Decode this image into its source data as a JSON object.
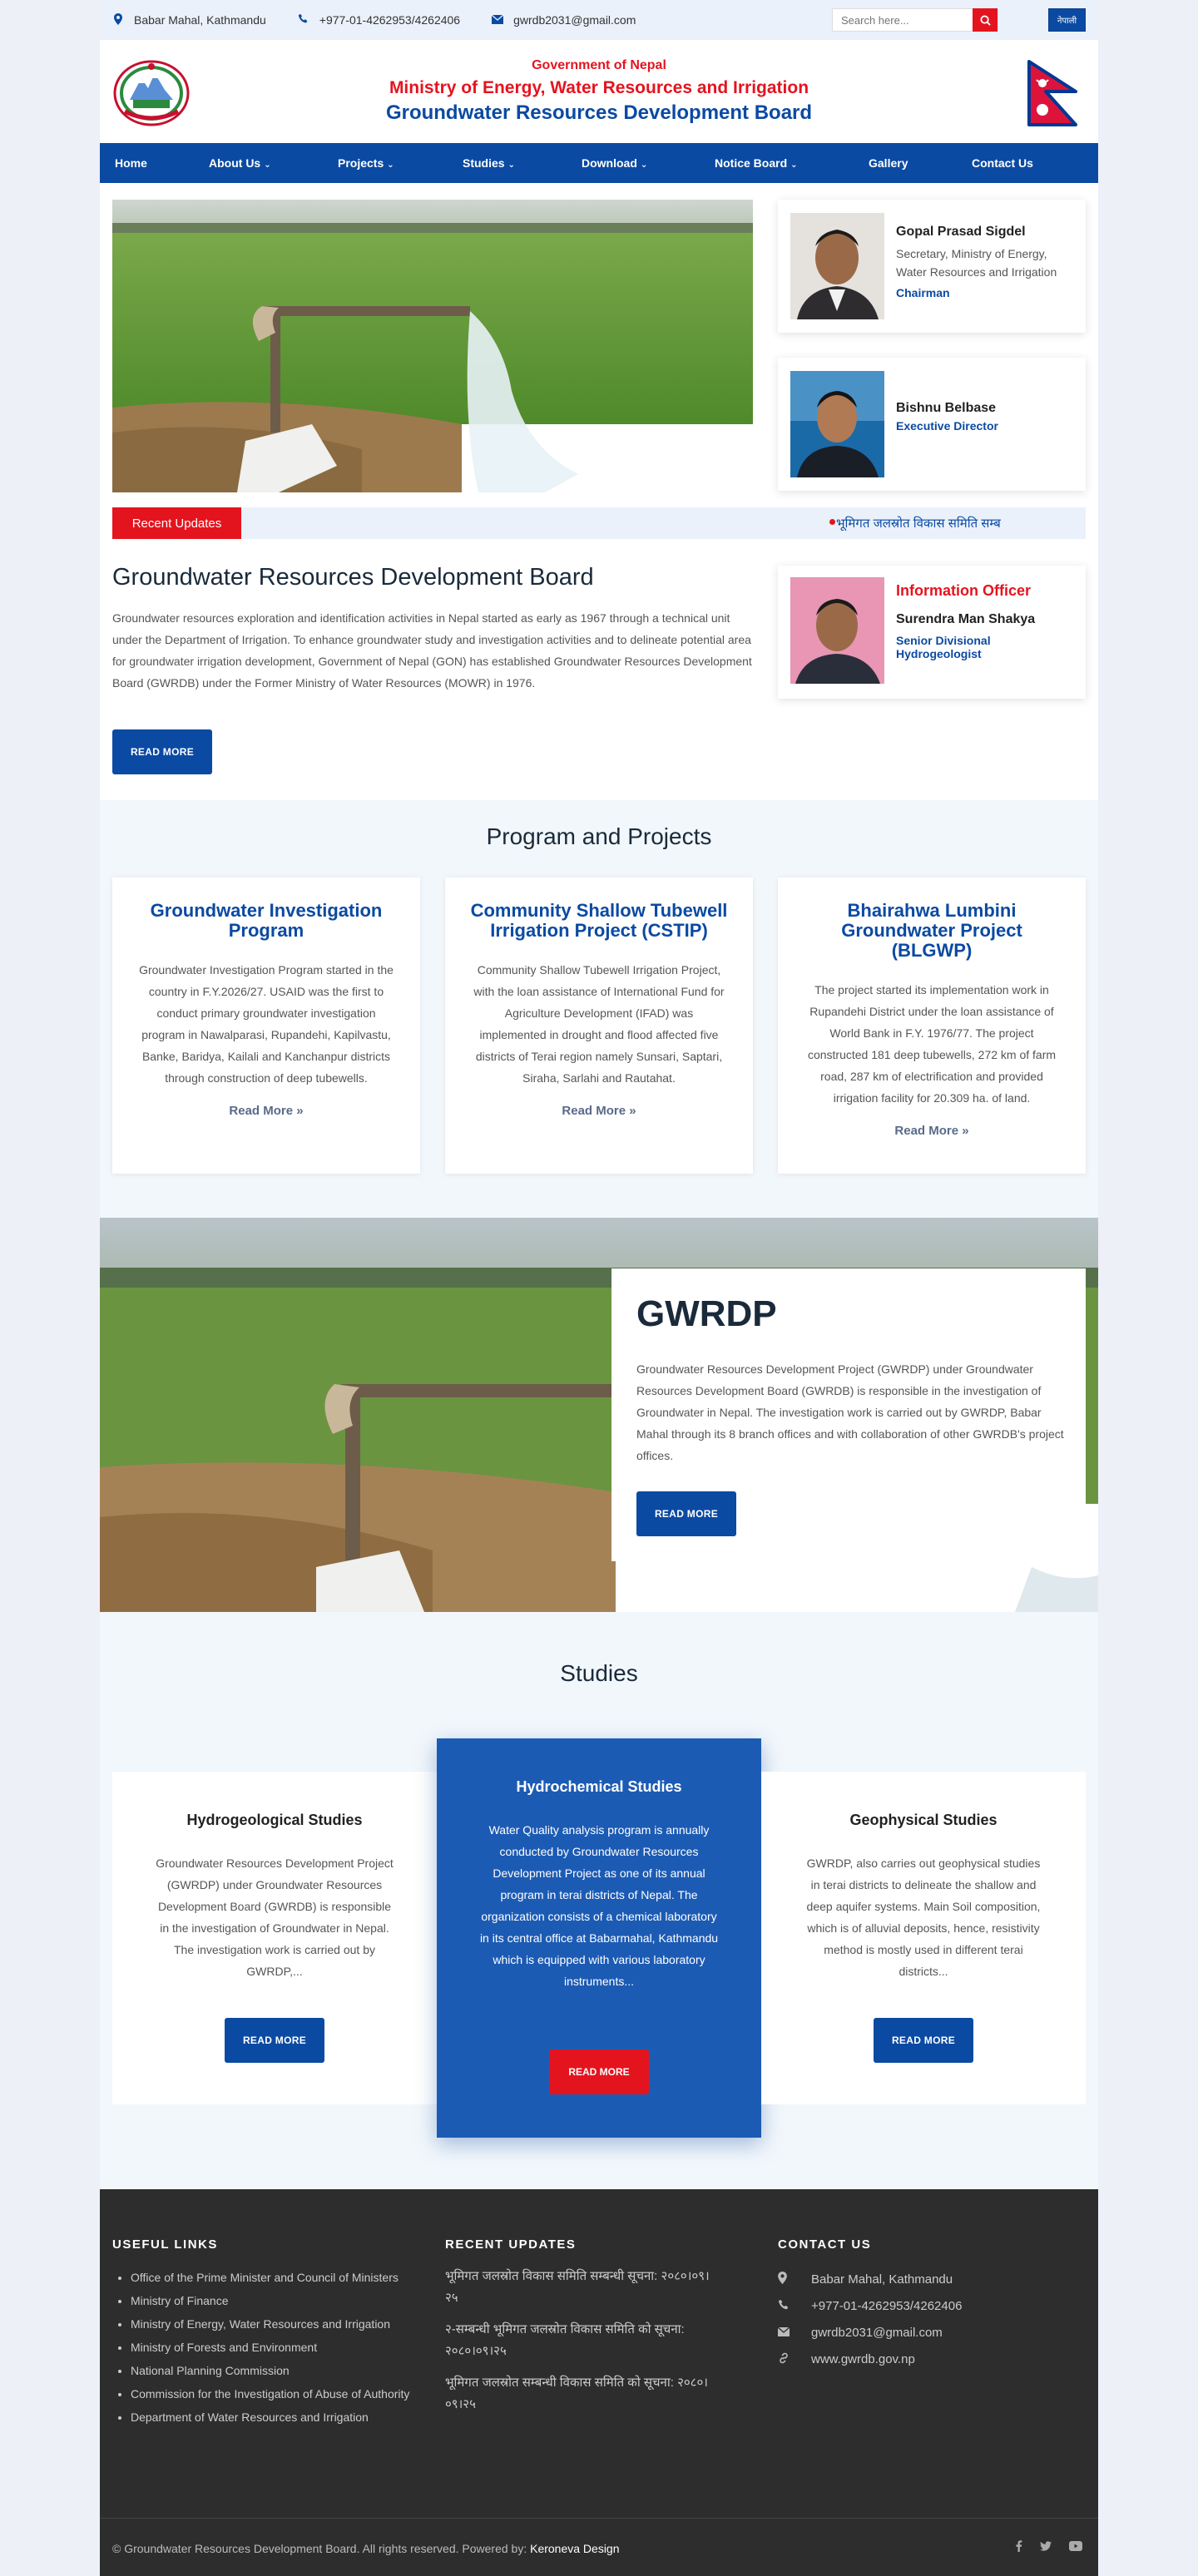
{
  "topbar": {
    "address": "Babar Mahal, Kathmandu",
    "phone": "+977-01-4262953/4262406",
    "email": "gwrdb2031@gmail.com",
    "search_placeholder": "Search here...",
    "lang_button": "नेपाली",
    "icons": [
      "map-pin-icon",
      "phone-icon",
      "envelope-icon",
      "search-icon"
    ]
  },
  "header": {
    "gov": "Government of Nepal",
    "ministry": "Ministry of Energy, Water Resources and Irrigation",
    "board": "Groundwater Resources Development Board"
  },
  "nav": [
    {
      "label": "Home",
      "dropdown": false
    },
    {
      "label": "About Us",
      "dropdown": true
    },
    {
      "label": "Projects",
      "dropdown": true
    },
    {
      "label": "Studies",
      "dropdown": true
    },
    {
      "label": "Download",
      "dropdown": true
    },
    {
      "label": "Notice Board",
      "dropdown": true
    },
    {
      "label": "Gallery",
      "dropdown": false
    },
    {
      "label": "Contact Us",
      "dropdown": false
    }
  ],
  "officials": [
    {
      "name": "Gopal Prasad Sigdel",
      "desc": "Secretary, Ministry of Energy, Water Resources and Irrigation",
      "role": "Chairman"
    },
    {
      "name": "Bishnu Belbase",
      "desc": "",
      "role": "Executive Director"
    }
  ],
  "updates": {
    "label": "Recent Updates",
    "ticker": "भूमिगत जलस्रोत विकास समिति सम्ब"
  },
  "intro": {
    "title": "Groundwater Resources Development Board",
    "text": "Groundwater resources exploration and identification activities in Nepal started as early as 1967 through a technical unit under the Department of Irrigation. To enhance groundwater study and investigation activities and to delineate potential area for groundwater irrigation development, Government of Nepal (GON) has established Groundwater Resources Development Board (GWRDB) under the Former Ministry of Water Resources (MOWR) in 1976.",
    "button": "READ MORE"
  },
  "info_officer": {
    "heading": "Information Officer",
    "name": "Surendra Man Shakya",
    "role": "Senior Divisional Hydrogeologist"
  },
  "programs": {
    "title": "Program and Projects",
    "items": [
      {
        "title": "Groundwater Investigation Program",
        "text": "Groundwater Investigation Program started in the country in F.Y.2026/27. USAID was the first to conduct primary groundwater investigation program in Nawalparasi, Rupandehi, Kapilvastu, Banke, Baridya, Kailali and Kanchanpur districts through construction of deep tubewells.",
        "link": "Read More"
      },
      {
        "title": "Community Shallow Tubewell Irrigation Project (CSTIP)",
        "text": "Community Shallow Tubewell Irrigation Project, with the loan assistance of International Fund for Agriculture Development (IFAD) was implemented in drought and flood affected five districts of Terai region namely Sunsari, Saptari, Siraha, Sarlahi and Rautahat.",
        "link": "Read More"
      },
      {
        "title": "Bhairahwa Lumbini Groundwater Project (BLGWP)",
        "text": "The project started its implementation work in Rupandehi District under the loan assistance of World Bank in F.Y. 1976/77. The project constructed 181 deep tubewells, 272 km of farm road, 287 km of electrification and provided irrigation facility for 20.309 ha. of land.",
        "link": "Read More"
      }
    ]
  },
  "gwrdp": {
    "title": "GWRDP",
    "text": "Groundwater Resources Development Project (GWRDP) under Groundwater Resources Development Board (GWRDB) is responsible in the investigation of Groundwater in Nepal. The investigation work is carried out by GWRDP, Babar Mahal through its 8 branch offices and with collaboration of other GWRDB's project offices.",
    "button": "READ MORE"
  },
  "studies": {
    "title": "Studies",
    "items": [
      {
        "title": "Hydrogeological Studies",
        "text": "Groundwater Resources Development Project (GWRDP) under Groundwater Resources Development Board (GWRDB) is responsible in the investigation of Groundwater in Nepal. The investigation work is carried out by GWRDP,...",
        "button": "READ MORE"
      },
      {
        "title": "Hydrochemical Studies",
        "text": "Water Quality analysis program is annually conducted by Groundwater Resources Development Project as one of its annual program in terai districts of Nepal. The organization consists of a chemical laboratory in its central office at Babarmahal, Kathmandu which is equipped with various laboratory instruments...",
        "button": "READ MORE"
      },
      {
        "title": "Geophysical Studies",
        "text": "GWRDP, also carries out geophysical studies in terai districts to delineate the shallow and deep aquifer systems. Main Soil composition, which is of alluvial deposits, hence, resistivity method is mostly used in different terai districts...",
        "button": "READ MORE"
      }
    ]
  },
  "footer": {
    "useful_title": "USEFUL LINKS",
    "useful_links": [
      "Office of the Prime Minister and Council of Ministers",
      "Ministry of Finance",
      "Ministry of Energy, Water Resources and Irrigation",
      "Ministry of Forests and Environment",
      "National Planning Commission",
      "Commission for the Investigation of Abuse of Authority",
      "Department of Water Resources and Irrigation"
    ],
    "updates_title": "RECENT UPDATES",
    "updates": [
      "भूमिगत जलस्रोत विकास समिति सम्बन्धी सूचना: २०८०।०९।२५",
      "२-सम्बन्धी भूमिगत जलस्रोत विकास समिति को सूचना: २०८०।०९।२५",
      "भूमिगत जलस्रोत सम्बन्धी विकास समिति को सूचना: २०८०।०९।२५"
    ],
    "contact_title": "CONTACT US",
    "contact": [
      {
        "icon": "map-pin-icon",
        "text": "Babar Mahal, Kathmandu"
      },
      {
        "icon": "phone-icon",
        "text": "+977-01-4262953/4262406"
      },
      {
        "icon": "envelope-icon",
        "text": "gwrdb2031@gmail.com"
      },
      {
        "icon": "link-icon",
        "text": "www.gwrdb.gov.np"
      }
    ],
    "copyright": "© Groundwater Resources Development Board. All rights reserved. Powered by:",
    "powered": "Keroneva Design",
    "social": [
      "facebook-icon",
      "twitter-icon",
      "youtube-icon"
    ]
  },
  "colors": {
    "primary": "#0b4aa2",
    "accent": "#e4141f",
    "footer": "#2d2d2d"
  }
}
